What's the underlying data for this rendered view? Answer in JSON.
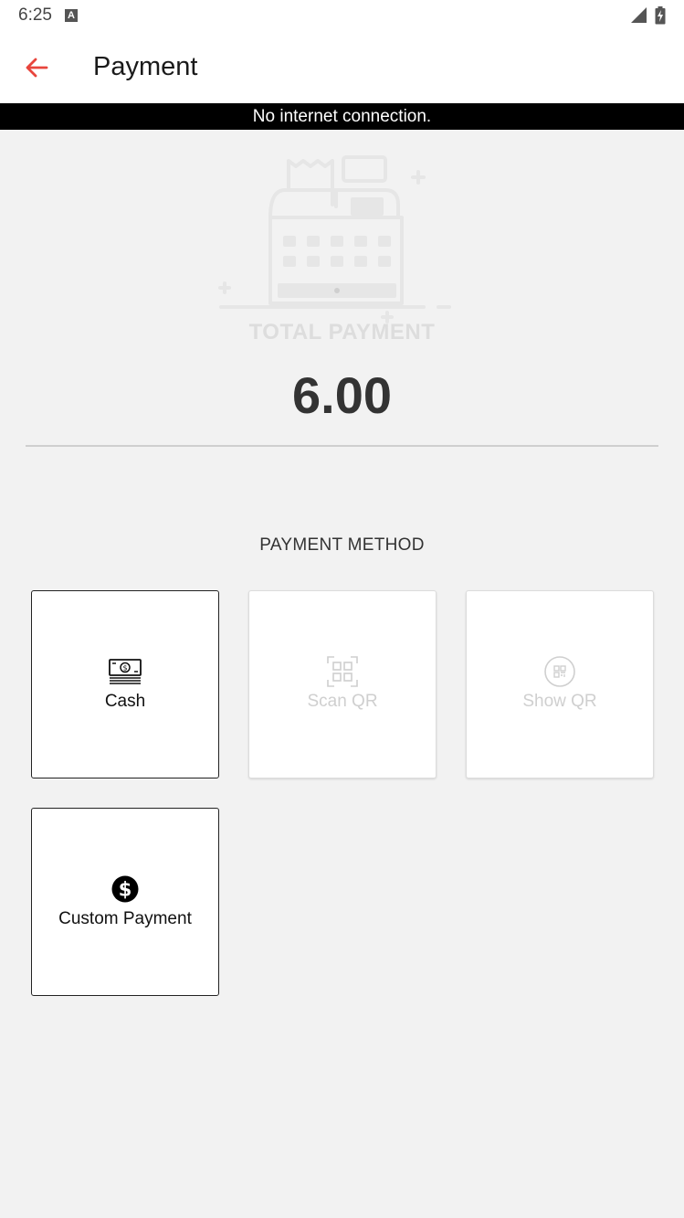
{
  "status_bar": {
    "time": "6:25",
    "notification_icon": "a-icon",
    "signal_icon": "signal-icon",
    "battery_icon": "battery-charging-icon"
  },
  "app_bar": {
    "back_icon": "arrow-left-icon",
    "title": "Payment",
    "accent_color": "#e8453c"
  },
  "banner": {
    "text": "No internet connection."
  },
  "summary": {
    "illustration": "cash-register-icon",
    "total_label": "TOTAL PAYMENT",
    "total_amount": "6.00"
  },
  "payment_methods": {
    "heading": "PAYMENT METHOD",
    "items": [
      {
        "label": "Cash",
        "icon": "cash-icon",
        "enabled": true
      },
      {
        "label": "Scan QR",
        "icon": "scan-qr-icon",
        "enabled": false
      },
      {
        "label": "Show QR",
        "icon": "show-qr-icon",
        "enabled": false
      },
      {
        "label": "Custom Payment",
        "icon": "dollar-icon",
        "enabled": true
      }
    ]
  }
}
